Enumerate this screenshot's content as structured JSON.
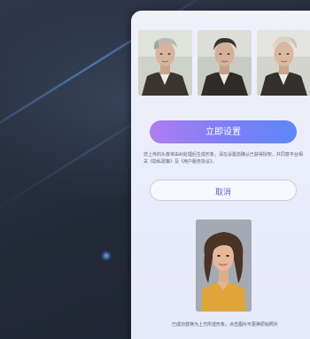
{
  "panel": {
    "primary_button_label": "立即设置",
    "notice_text": "您上传的头像将由AI处理后生成形象，请在设置前确认已获得授权，并同意平台相关《隐私政策》及《用户服务协议》。",
    "cancel_button_label": "取消",
    "footer_text": "已成功替换为上方所选形象，点击图片可更换原始照片"
  },
  "colors": {
    "primary_gradient_start": "#b07cf0",
    "primary_gradient_end": "#5e86f8",
    "panel_background": "#eef0fb",
    "background": "#2a3242"
  },
  "icons": {
    "thumbnails": [
      "avatar-style-1-thumbnail",
      "avatar-style-2-thumbnail",
      "avatar-style-3-thumbnail"
    ],
    "portrait": "user-portrait-photo"
  }
}
